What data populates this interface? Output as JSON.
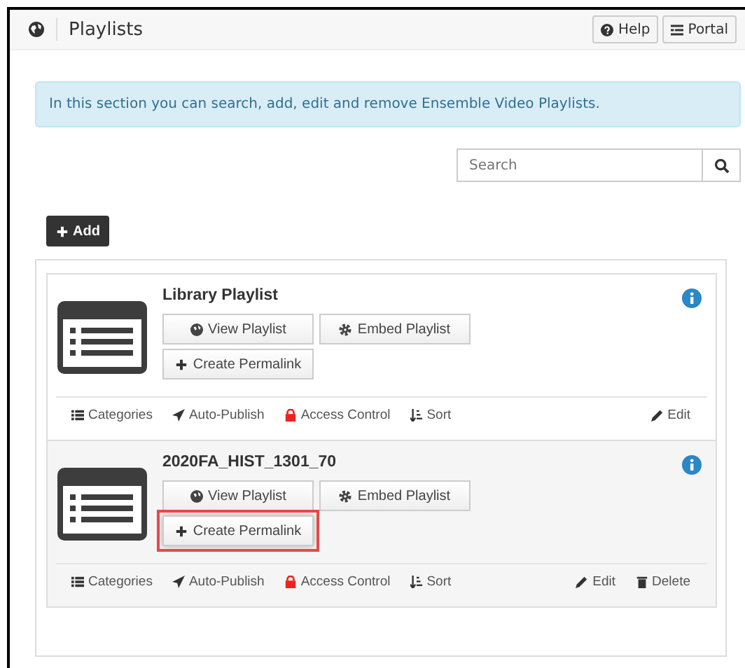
{
  "header": {
    "title": "Playlists",
    "buttons": [
      {
        "kind": "help",
        "label": "Help"
      },
      {
        "kind": "portal",
        "label": "Portal"
      }
    ]
  },
  "alert": "In this section you can search, add, edit and remove Ensemble Video Playlists.",
  "search": {
    "placeholder": "Search"
  },
  "add_button": "Add",
  "playlists": [
    {
      "title": "Library Playlist",
      "hovered": false,
      "buttons": [
        {
          "kind": "view",
          "label": "View Playlist",
          "highlighted": false
        },
        {
          "kind": "embed",
          "label": "Embed Playlist",
          "highlighted": false
        },
        {
          "kind": "permalink",
          "label": "Create Permalink",
          "highlighted": false
        }
      ],
      "actions": [
        {
          "kind": "categories",
          "label": "Categories"
        },
        {
          "kind": "publish",
          "label": "Auto-Publish"
        },
        {
          "kind": "access",
          "label": "Access Control"
        },
        {
          "kind": "sort",
          "label": "Sort"
        },
        {
          "kind": "edit",
          "label": "Edit"
        }
      ]
    },
    {
      "title": "2020FA_HIST_1301_70",
      "hovered": true,
      "buttons": [
        {
          "kind": "view",
          "label": "View Playlist",
          "highlighted": false
        },
        {
          "kind": "embed",
          "label": "Embed Playlist",
          "highlighted": false
        },
        {
          "kind": "permalink",
          "label": "Create Permalink",
          "highlighted": true
        }
      ],
      "actions": [
        {
          "kind": "categories",
          "label": "Categories"
        },
        {
          "kind": "publish",
          "label": "Auto-Publish"
        },
        {
          "kind": "access",
          "label": "Access Control"
        },
        {
          "kind": "sort",
          "label": "Sort"
        },
        {
          "kind": "edit",
          "label": "Edit"
        },
        {
          "kind": "delete",
          "label": "Delete"
        }
      ]
    }
  ]
}
